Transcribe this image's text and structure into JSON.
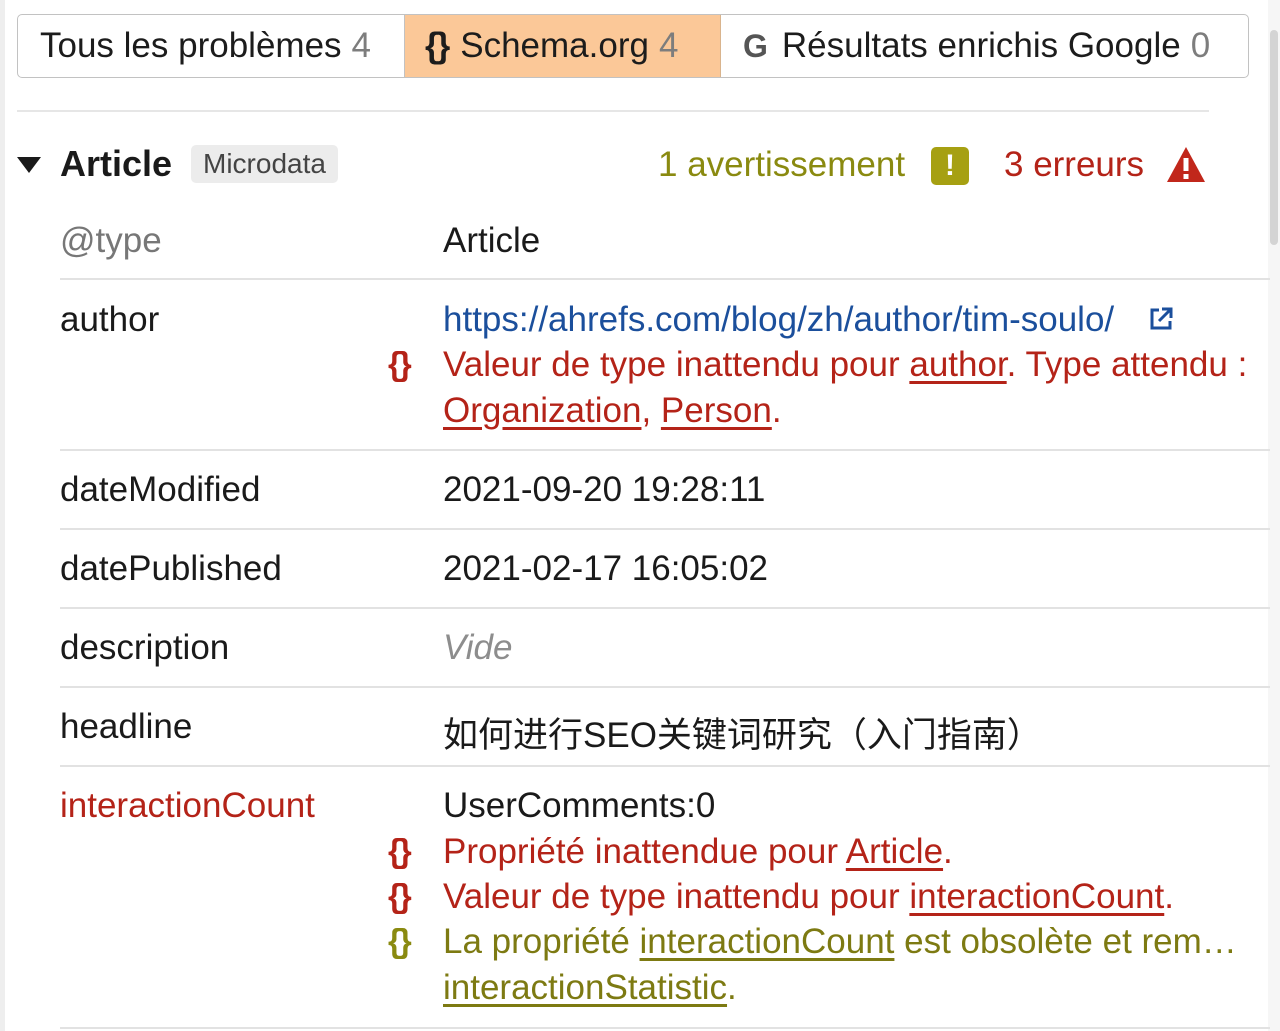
{
  "tabs": [
    {
      "label": "Tous les problèmes",
      "count": "4",
      "selected": false
    },
    {
      "label": "Schema.org",
      "count": "4",
      "selected": true,
      "icon": "braces-icon"
    },
    {
      "label": "Résultats enrichis Google",
      "count": "0",
      "selected": false,
      "icon": "google-icon"
    }
  ],
  "item": {
    "title": "Article",
    "badge": "Microdata",
    "warnings": "1 avertissement",
    "errors": "3 erreurs"
  },
  "rows": {
    "type": {
      "key": "@type",
      "value": "Article"
    },
    "author": {
      "key": "author",
      "value": "https://ahrefs.com/blog/zh/author/tim-soulo/",
      "msg_prefix": "Valeur de type inattendu pour ",
      "msg_link": "author",
      "msg_suffix": ". Type attendu :",
      "line2_link1": "Organization",
      "line2_sep": ", ",
      "line2_link2": "Person",
      "line2_end": "."
    },
    "dateModified": {
      "key": "dateModified",
      "value": "2021-09-20 19:28:11"
    },
    "datePublished": {
      "key": "datePublished",
      "value": "2021-02-17 16:05:02"
    },
    "description": {
      "key": "description",
      "value": "Vide"
    },
    "headline": {
      "key": "headline",
      "value": "如何进行SEO关键词研究（入门指南）"
    },
    "interactionCount": {
      "key": "interactionCount",
      "value": "UserComments:0",
      "m1_prefix": "Propriété inattendue pour ",
      "m1_link": "Article",
      "m1_end": ".",
      "m2_prefix": "Valeur de type inattendu pour ",
      "m2_link": "interactionCount",
      "m2_end": ".",
      "m3_prefix": "La propriété ",
      "m3_link": "interactionCount",
      "m3_suffix": " est obsolète et rem…",
      "m3_line2_link": "interactionStatistic",
      "m3_line2_end": "."
    }
  },
  "colors": {
    "error": "#b42318",
    "warning": "#8a8a10",
    "link": "#1b4f9c",
    "selected_tab": "#fbc898"
  }
}
